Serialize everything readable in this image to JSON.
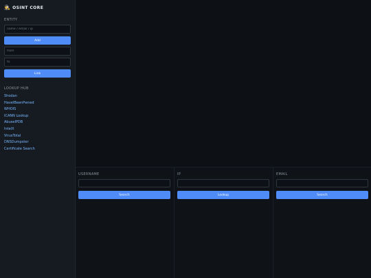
{
  "brand": {
    "icon": "detective-icon",
    "glyph": "🕵",
    "title": "OSINT CORE"
  },
  "entity": {
    "label": "ENTITY",
    "input_placeholder": "name / email / ip",
    "add_label": "Add",
    "from_placeholder": "from",
    "to_placeholder": "to",
    "link_label": "Link"
  },
  "lookup_hub": {
    "label": "LOOKUP HUB",
    "items": [
      "Shodan",
      "HaveIBeenPwned",
      "WHOIS",
      "ICANN Lookup",
      "AbuseIPDB",
      "IntelX",
      "VirusTotal",
      "DNSDumpster",
      "Certificate Search"
    ]
  },
  "panels": [
    {
      "label": "USERNAME",
      "placeholder": "",
      "button": "Search"
    },
    {
      "label": "IP",
      "placeholder": "",
      "button": "Lookup"
    },
    {
      "label": "EMAIL",
      "placeholder": "",
      "button": "Search"
    }
  ],
  "colors": {
    "accent": "#4f8cf7",
    "link": "#79b8ff",
    "sidebar_bg": "#161b22",
    "page_bg": "#0d1014"
  }
}
